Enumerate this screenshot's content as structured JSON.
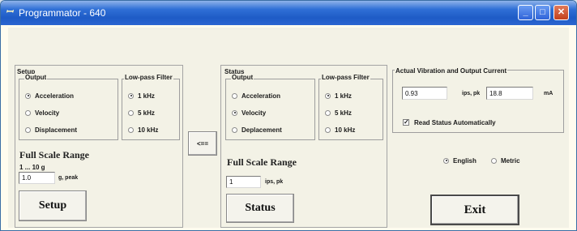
{
  "window": {
    "title": "Programmator - 640",
    "app_icon": "app-icon",
    "controls": {
      "minimize": "minimize-icon",
      "maximize": "maximize-icon",
      "close": "close-icon"
    }
  },
  "setup": {
    "title": "Setup",
    "output": {
      "legend": "Output",
      "options": [
        {
          "label": "Acceleration",
          "selected": true
        },
        {
          "label": "Velocity",
          "selected": false
        },
        {
          "label": "Displacement",
          "selected": false
        }
      ]
    },
    "filter": {
      "legend": "Low-pass Filter",
      "options": [
        {
          "label": "1 kHz",
          "selected": true
        },
        {
          "label": "5 kHz",
          "selected": false
        },
        {
          "label": "10 kHz",
          "selected": false
        }
      ]
    },
    "full_scale_label": "Full Scale Range",
    "range_hint": "1 ... 10 g",
    "value": "1.0",
    "unit": "g, peak",
    "button": "Setup"
  },
  "copy_button": "<==",
  "status": {
    "title": "Status",
    "output": {
      "legend": "Output",
      "options": [
        {
          "label": "Acceleration",
          "selected": false
        },
        {
          "label": "Velocity",
          "selected": true
        },
        {
          "label": "Deplacement",
          "selected": false
        }
      ]
    },
    "filter": {
      "legend": "Low-pass Filter",
      "options": [
        {
          "label": "1 kHz",
          "selected": true
        },
        {
          "label": "5 kHz",
          "selected": false
        },
        {
          "label": "10 kHz",
          "selected": false
        }
      ]
    },
    "full_scale_label": "Full Scale Range",
    "value": "1",
    "unit": "ips, pk",
    "button": "Status"
  },
  "actual": {
    "legend": "Actual Vibration and Output Current",
    "vibration_value": "0.93",
    "vibration_unit": "ips, pk",
    "current_value": "18.8",
    "current_unit": "mA",
    "read_status_label": "Read Status Automatically",
    "read_status_checked": true,
    "units": [
      {
        "label": "English",
        "selected": true
      },
      {
        "label": "Metric",
        "selected": false
      }
    ],
    "exit_button": "Exit"
  }
}
